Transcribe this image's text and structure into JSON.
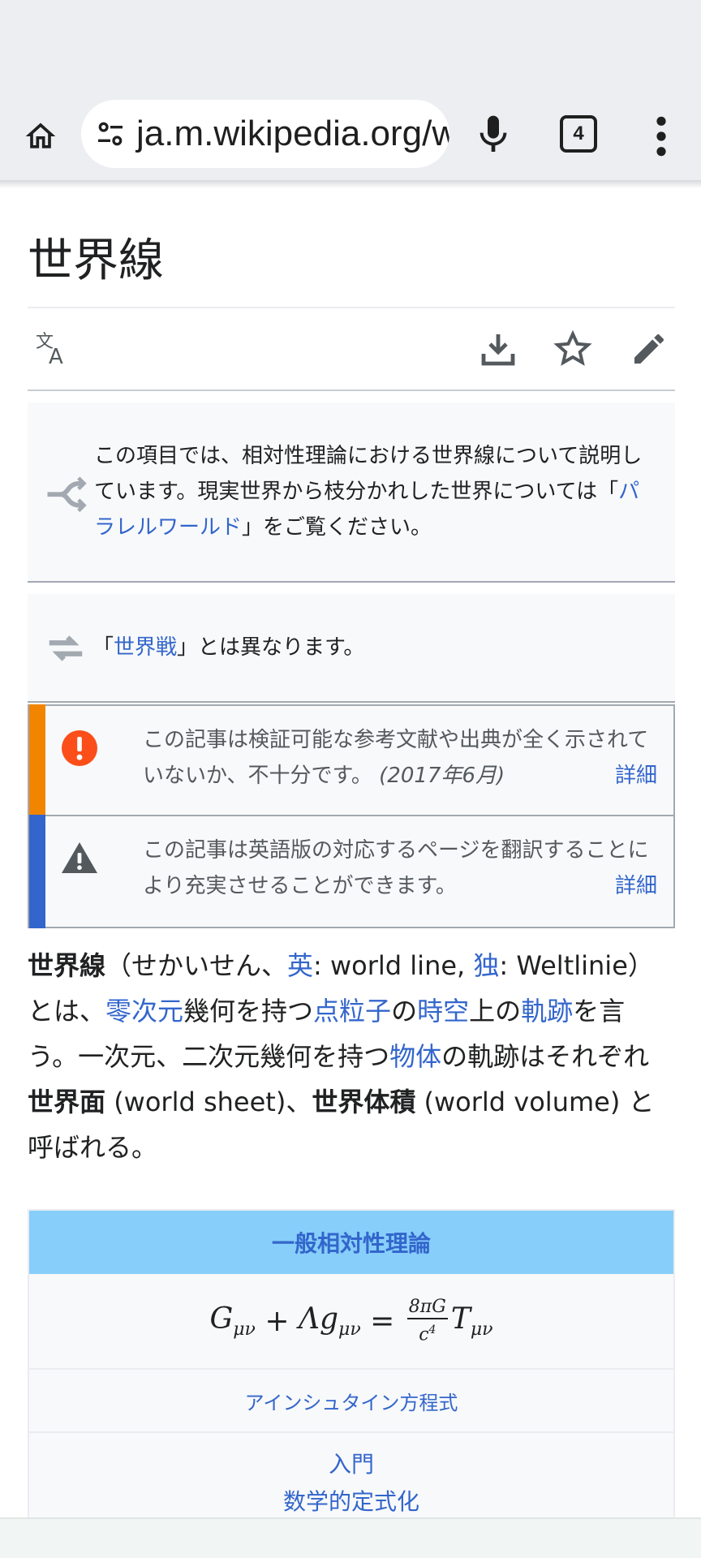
{
  "browser": {
    "url": "ja.m.wikipedia.org/w",
    "tab_count": "4"
  },
  "article": {
    "title": "世界線"
  },
  "hatnotes": [
    {
      "text_before": "この項目では、相対性理論における世界線について説明しています。現実世界から枝分かれした世界については「",
      "link": "パラレルワールド",
      "text_after": "」をご覧ください。"
    },
    {
      "text_before": "「",
      "link": "世界戦",
      "text_after": "」とは異なります。"
    }
  ],
  "notices": [
    {
      "text": "この記事は検証可能な参考文献や出典が全く示されていないか、不十分です。",
      "date": "(2017年6月)",
      "more": "詳細",
      "color": "#f28500"
    },
    {
      "text": "この記事は英語版の対応するページを翻訳することにより充実させることができます。",
      "more": "詳細",
      "color": "#3366cc"
    }
  ],
  "lead": {
    "t1": "世界線",
    "t2": "（せかいせん、",
    "t3": "英",
    "t4": ": world line, ",
    "t5": "独",
    "t6": ": Weltlinie）とは、",
    "t7": "零次元",
    "t8": "幾何を持つ",
    "t9": "点粒子",
    "t10": "の",
    "t11": "時空",
    "t12": "上の",
    "t13": "軌跡",
    "t14": "を言う。一次元、二次元幾何を持つ",
    "t15": "物体",
    "t16": "の軌跡はそれぞれ",
    "t17": "世界面",
    "t18": " (world sheet)、",
    "t19": "世界体積",
    "t20": " (world volume) と呼ばれる。"
  },
  "infobox": {
    "heading": "一般相対性理論",
    "equation_link": "アインシュタイン方程式",
    "links": [
      "入門",
      "数学的定式化"
    ]
  }
}
